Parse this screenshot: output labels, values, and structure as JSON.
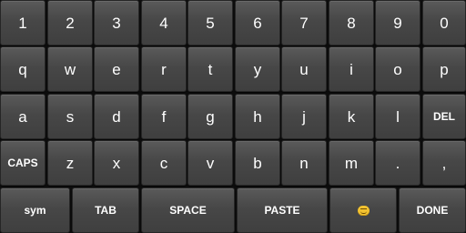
{
  "keyboard": {
    "rows": [
      [
        "1",
        "2",
        "3",
        "4",
        "5",
        "6",
        "7",
        "8",
        "9",
        "0"
      ],
      [
        "q",
        "w",
        "e",
        "r",
        "t",
        "y",
        "u",
        "i",
        "o",
        "p"
      ],
      [
        "a",
        "s",
        "d",
        "f",
        "g",
        "h",
        "j",
        "k",
        "l",
        "DEL"
      ],
      [
        "CAPS",
        "z",
        "x",
        "c",
        "v",
        "b",
        "n",
        "m",
        ".",
        ","
      ],
      [
        "sym",
        "TAB",
        "SPACE",
        "PASTE",
        "emoji",
        "DONE"
      ]
    ],
    "icons": {
      "emoji": "smiley-face-icon"
    },
    "colors": {
      "background": "#0d0d0d",
      "key": "#4a4a4a",
      "text": "#ffffff"
    }
  }
}
